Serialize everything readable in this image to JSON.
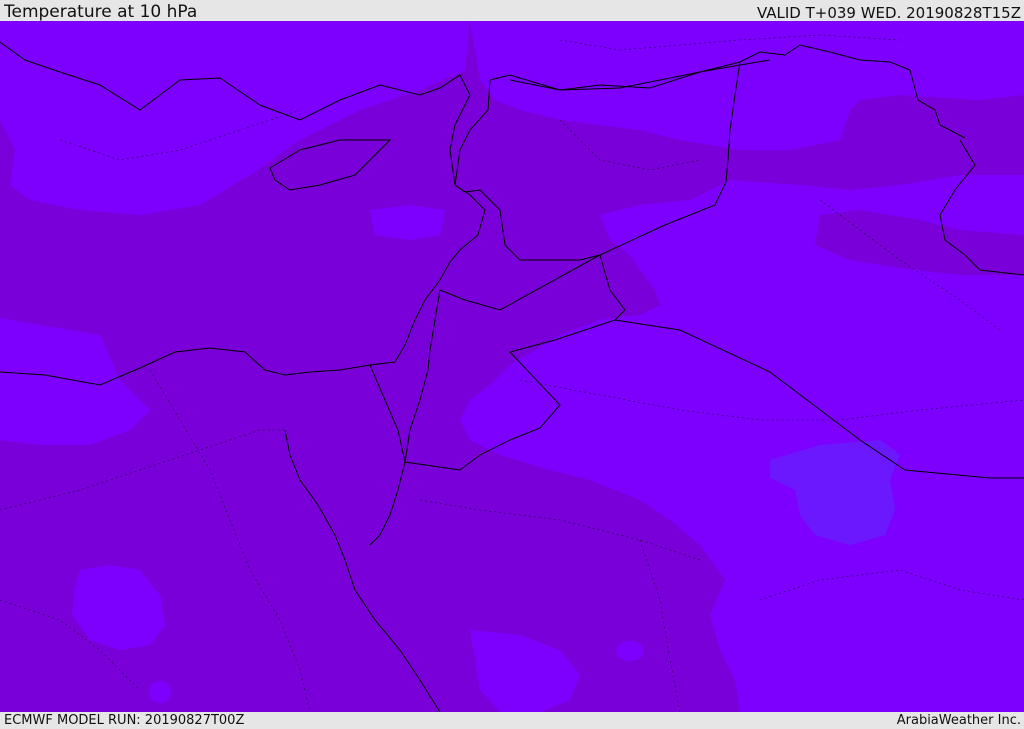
{
  "header": {
    "title": "Temperature at 10 hPa",
    "valid": "VALID T+039 WED. 20190828T15Z"
  },
  "footer": {
    "model_run": "ECMWF MODEL RUN: 20190827T00Z",
    "credit": "ArabiaWeather Inc."
  },
  "colors": {
    "fill_warm": "#7a00da",
    "fill_cool": "#7d00ff",
    "fill_coldest": "#6c18ff",
    "bar_background": "#e6e6e6",
    "borders": "#000000"
  }
}
